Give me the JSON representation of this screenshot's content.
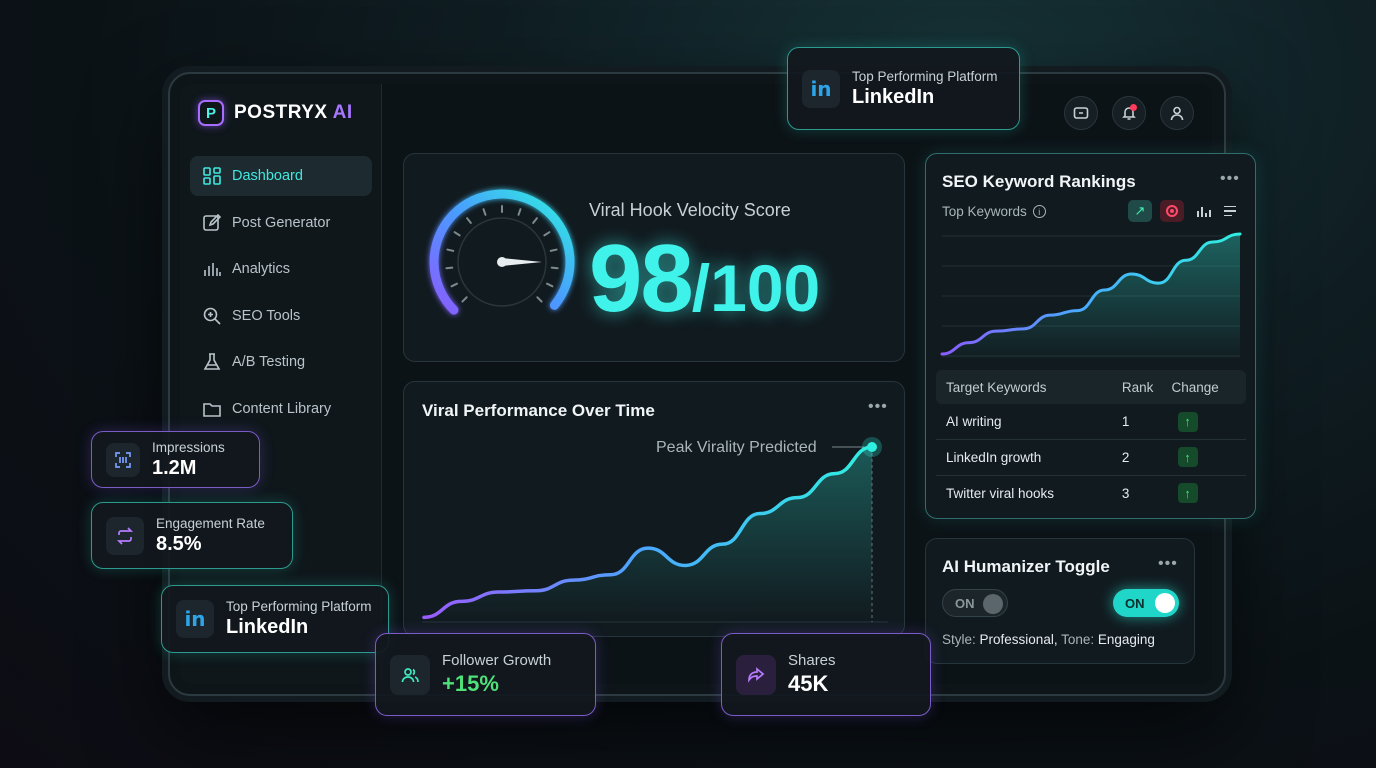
{
  "app": {
    "name": "POSTRYX",
    "name_suffix": "AI"
  },
  "sidebar": {
    "items": [
      {
        "label": "Dashboard",
        "icon": "grid-icon",
        "active": true
      },
      {
        "label": "Post Generator",
        "icon": "edit-icon"
      },
      {
        "label": "Analytics",
        "icon": "bar-chart-icon"
      },
      {
        "label": "SEO Tools",
        "icon": "search-gear-icon"
      },
      {
        "label": "A/B Testing",
        "icon": "flask-icon"
      },
      {
        "label": "Content Library",
        "icon": "folder-icon"
      }
    ]
  },
  "header": {
    "icons": [
      "monitor-icon",
      "bell-icon",
      "user-icon"
    ],
    "notification_dot": true
  },
  "velocity": {
    "title": "Viral Hook Velocity Score",
    "score": "98",
    "max": "/100",
    "gauge_fraction": 0.98
  },
  "performance": {
    "title": "Viral Performance Over Time",
    "annotation": "Peak Virality Predicted",
    "chart_data": {
      "type": "area",
      "x": [
        0,
        1,
        2,
        3,
        4,
        5,
        6,
        7,
        8,
        9,
        10,
        11,
        12
      ],
      "values": [
        2,
        14,
        21,
        22,
        30,
        34,
        54,
        41,
        57,
        80,
        92,
        110,
        130
      ]
    }
  },
  "seo": {
    "title": "SEO Keyword Rankings",
    "subtitle": "Top Keywords",
    "chart_data": {
      "type": "area",
      "x": [
        0,
        1,
        2,
        3,
        4,
        5,
        6,
        7,
        8,
        9,
        10,
        11
      ],
      "values": [
        0,
        10,
        20,
        22,
        34,
        38,
        56,
        70,
        62,
        82,
        98,
        105
      ]
    },
    "columns": [
      "Target Keywords",
      "Rank",
      "Change"
    ],
    "rows": [
      {
        "keyword": "AI writing",
        "rank": "1",
        "change": "↑"
      },
      {
        "keyword": "LinkedIn growth",
        "rank": "2",
        "change": "↑"
      },
      {
        "keyword": "Twitter viral hooks",
        "rank": "3",
        "change": "↑"
      }
    ]
  },
  "humanizer": {
    "title": "AI Humanizer Toggle",
    "toggle_off_label": "ON",
    "toggle_on_label": "ON",
    "style_label": "Style:",
    "style_value": "Professional,",
    "tone_label": "Tone:",
    "tone_value": "Engaging"
  },
  "floats": {
    "top_platform": {
      "label": "Top Performing Platform",
      "value": "LinkedIn",
      "icon_text": "in"
    },
    "impressions": {
      "label": "Impressions",
      "value": "1.2M"
    },
    "engagement": {
      "label": "Engagement Rate",
      "value": "8.5%"
    },
    "platform2": {
      "label": "Top Performing Platform",
      "value": "LinkedIn",
      "icon_text": "in"
    },
    "followers": {
      "label": "Follower Growth",
      "value": "+15%"
    },
    "shares": {
      "label": "Shares",
      "value": "45K"
    }
  },
  "colors": {
    "accent": "#3fe9e0",
    "purple": "#a777ff",
    "green": "#3ee07a"
  }
}
